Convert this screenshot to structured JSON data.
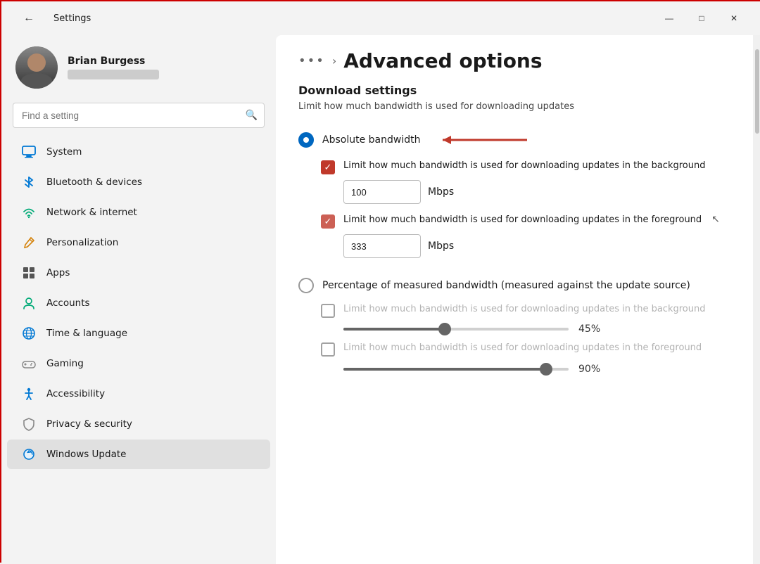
{
  "window": {
    "title": "Settings",
    "controls": {
      "minimize": "—",
      "maximize": "□",
      "close": "✕"
    }
  },
  "profile": {
    "name": "Brian Burgess",
    "email_placeholder": ""
  },
  "search": {
    "placeholder": "Find a setting"
  },
  "nav": {
    "items": [
      {
        "id": "system",
        "label": "System",
        "icon": "monitor"
      },
      {
        "id": "bluetooth",
        "label": "Bluetooth & devices",
        "icon": "bluetooth"
      },
      {
        "id": "network",
        "label": "Network & internet",
        "icon": "wifi"
      },
      {
        "id": "personalization",
        "label": "Personalization",
        "icon": "pencil"
      },
      {
        "id": "apps",
        "label": "Apps",
        "icon": "grid"
      },
      {
        "id": "accounts",
        "label": "Accounts",
        "icon": "person"
      },
      {
        "id": "time",
        "label": "Time & language",
        "icon": "globe"
      },
      {
        "id": "gaming",
        "label": "Gaming",
        "icon": "controller"
      },
      {
        "id": "accessibility",
        "label": "Accessibility",
        "icon": "accessibility"
      },
      {
        "id": "privacy",
        "label": "Privacy & security",
        "icon": "shield"
      },
      {
        "id": "update",
        "label": "Windows Update",
        "icon": "refresh",
        "active": true
      }
    ]
  },
  "main": {
    "breadcrumb_dots": "•••",
    "breadcrumb_arrow": "›",
    "page_title": "Advanced options",
    "section_title": "Download settings",
    "section_desc": "Limit how much bandwidth is used for downloading updates",
    "radio_options": [
      {
        "id": "absolute",
        "label": "Absolute bandwidth",
        "selected": true,
        "has_arrow": true
      },
      {
        "id": "percentage",
        "label": "Percentage of measured bandwidth (measured against the update source)",
        "selected": false
      }
    ],
    "absolute_options": {
      "background_checkbox": {
        "checked": true,
        "label": "Limit how much bandwidth is used for downloading updates in the background"
      },
      "background_input": {
        "value": "100",
        "unit": "Mbps"
      },
      "foreground_checkbox": {
        "checked": true,
        "label": "Limit how much bandwidth is used for downloading updates in the foreground"
      },
      "foreground_input": {
        "value": "333",
        "unit": "Mbps"
      }
    },
    "percentage_options": {
      "background_checkbox": {
        "checked": false,
        "label": "Limit how much bandwidth is used for downloading updates in the background",
        "disabled": true
      },
      "background_slider": {
        "value": 45,
        "display": "45%"
      },
      "foreground_checkbox": {
        "checked": false,
        "label": "Limit how much bandwidth is used for downloading updates in the foreground",
        "disabled": true
      },
      "foreground_slider": {
        "value": 90,
        "display": "90%"
      }
    }
  }
}
